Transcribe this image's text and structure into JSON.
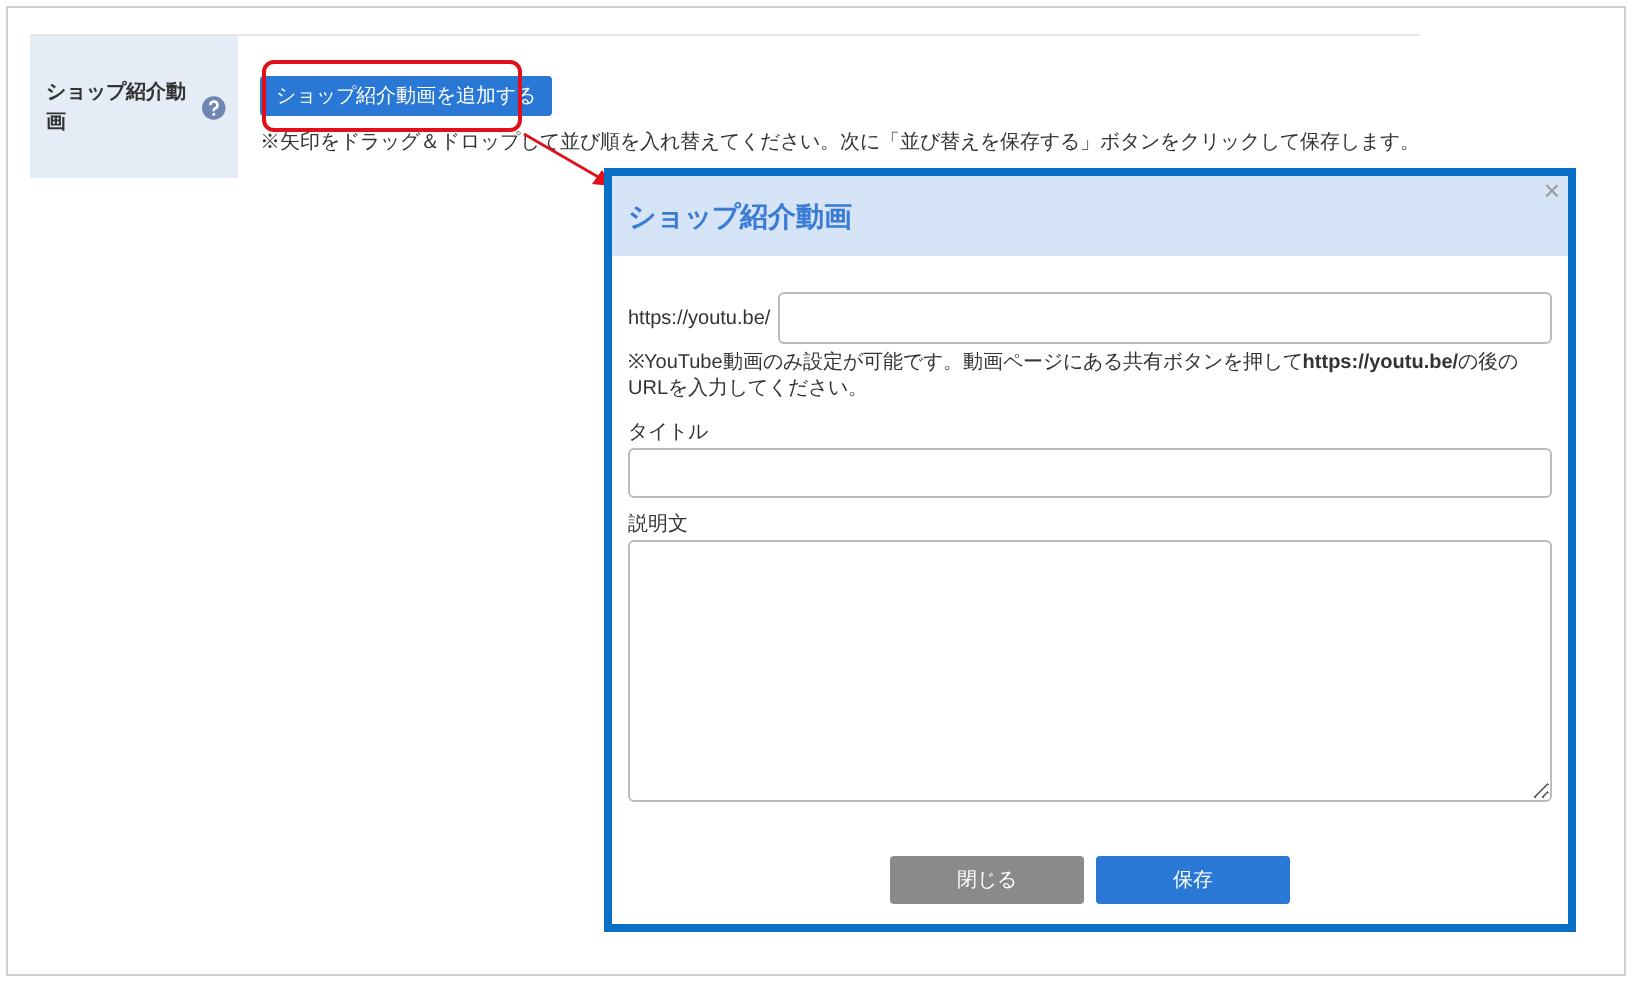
{
  "settings_row": {
    "label": "ショップ紹介動画",
    "add_button": "ショップ紹介動画を追加する",
    "note": "※矢印をドラッグ＆ドロップして並び順を入れ替えてください。次に「並び替えを保存する」ボタンをクリックして保存します。"
  },
  "modal": {
    "title": "ショップ紹介動画",
    "close": "×",
    "url_label": "https://youtu.be/",
    "url_help": "※YouTube動画のみ設定が可能です。動画ページにある共有ボタンを押して**https://youtu.be/**の後のURLを入力してください。",
    "title_label": "タイトル",
    "description_label": "説明文",
    "buttons": [
      {
        "label": "閉じる",
        "kind": "secondary"
      },
      {
        "label": "保存",
        "kind": "primary"
      }
    ]
  }
}
